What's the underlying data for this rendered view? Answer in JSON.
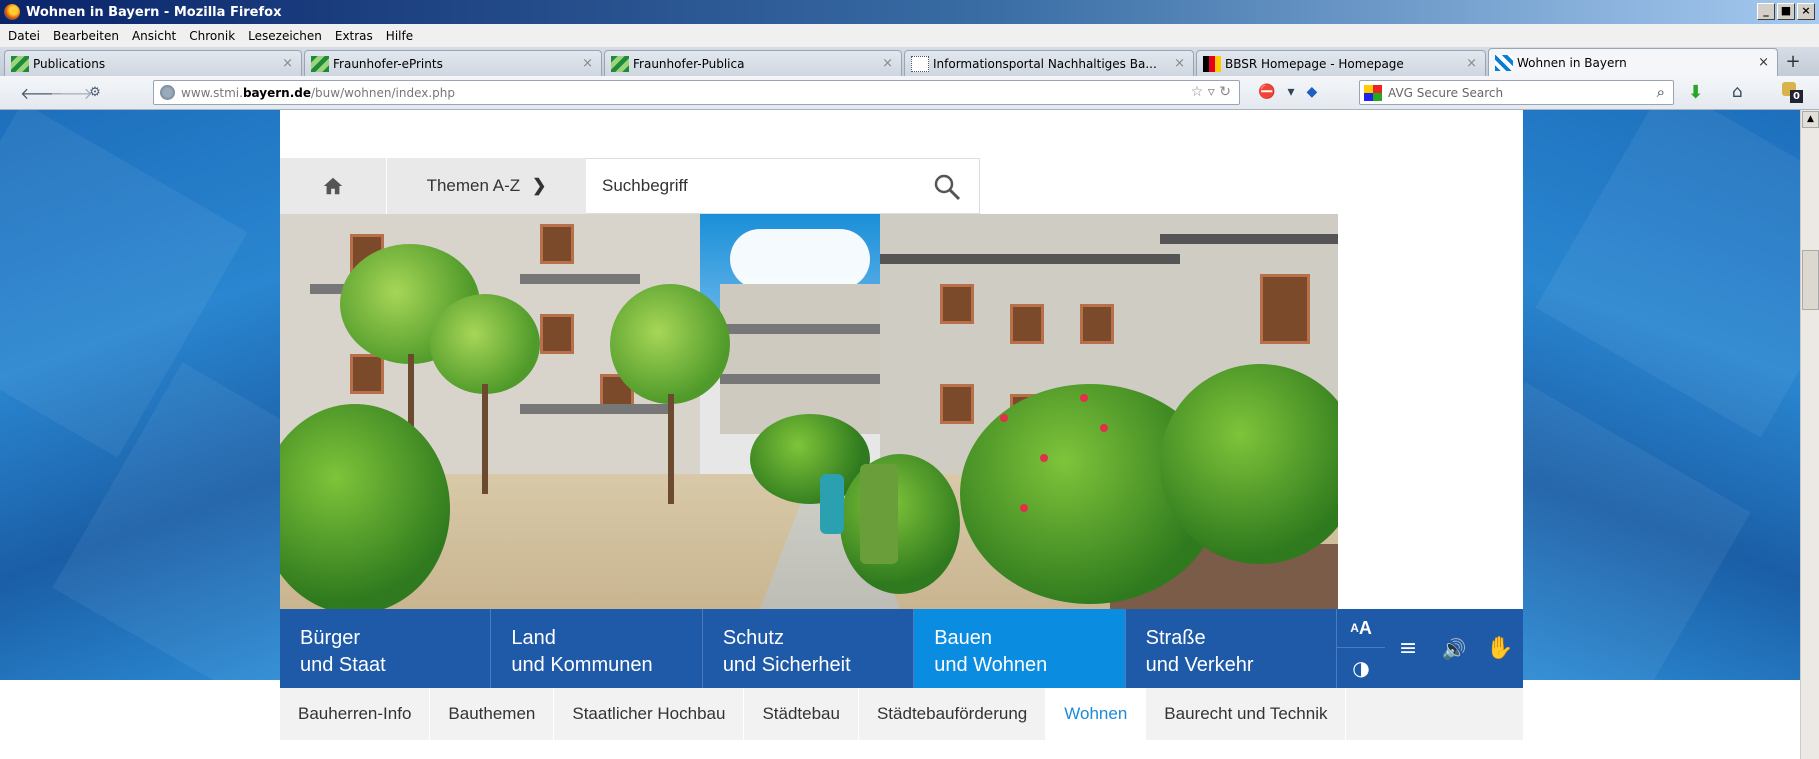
{
  "window": {
    "title": "Wohnen in Bayern - Mozilla Firefox",
    "buttons": [
      "_",
      "■",
      "×"
    ]
  },
  "menu": [
    "Datei",
    "Bearbeiten",
    "Ansicht",
    "Chronik",
    "Lesezeichen",
    "Extras",
    "Hilfe"
  ],
  "tabs": [
    {
      "label": "Publications",
      "icon": "fraunhofer-icon",
      "active": false
    },
    {
      "label": "Fraunhofer-ePrints",
      "icon": "fraunhofer-icon",
      "active": false
    },
    {
      "label": "Fraunhofer-Publica",
      "icon": "fraunhofer-icon",
      "active": false
    },
    {
      "label": "Informationsportal Nachhaltiges Ba...",
      "icon": "dotted-page-icon",
      "active": false
    },
    {
      "label": "BBSR Homepage - Homepage",
      "icon": "bbsr-icon",
      "active": false
    },
    {
      "label": "Wohnen in Bayern",
      "icon": "bayern-icon",
      "active": true
    }
  ],
  "navbar": {
    "url_prefix": "www.stmi.",
    "url_domain": "bayern.de",
    "url_path": "/buw/wohnen/index.php",
    "search_placeholder": "AVG Secure Search",
    "badge": "0"
  },
  "site": {
    "themen_label": "Themen A-Z",
    "chevron": "❯",
    "search_placeholder": "Suchbegriff",
    "main_nav": [
      {
        "line1": "Bürger",
        "line2": "und Staat",
        "active": false
      },
      {
        "line1": "Land",
        "line2": "und Kommunen",
        "active": false
      },
      {
        "line1": "Schutz",
        "line2": "und Sicherheit",
        "active": false
      },
      {
        "line1": "Bauen",
        "line2": "und Wohnen",
        "active": true
      },
      {
        "line1": "Straße",
        "line2": "und Verkehr",
        "active": false
      }
    ],
    "tools": {
      "font_size_label": "A",
      "font_size_small": "A",
      "contrast": "◑",
      "reader": "≡",
      "speaker": "🔊",
      "sign_language": "✋"
    },
    "sub_nav": [
      {
        "label": "Bauherren-Info",
        "active": false
      },
      {
        "label": "Bauthemen",
        "active": false
      },
      {
        "label": "Staatlicher Hochbau",
        "active": false
      },
      {
        "label": "Städtebau",
        "active": false
      },
      {
        "label": "Städtebauförderung",
        "active": false
      },
      {
        "label": "Wohnen",
        "active": true
      },
      {
        "label": "Baurecht und Technik",
        "active": false
      }
    ]
  },
  "colors": {
    "nav_blue": "#1e5aa8",
    "nav_active": "#0a8de0",
    "subnav_active_text": "#1f8ad6",
    "page_bg_blue": "#1d6fbc"
  }
}
